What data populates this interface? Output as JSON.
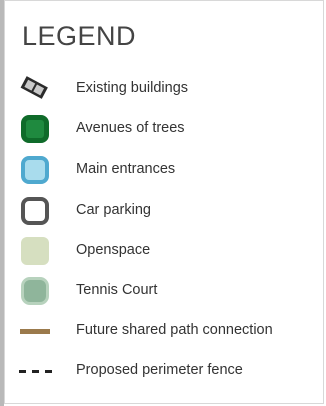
{
  "legend": {
    "title": "LEGEND",
    "items": [
      {
        "label": "Existing buildings",
        "icon": "building-icon",
        "color": "#2b2b2b"
      },
      {
        "label": "Avenues of trees",
        "icon": "trees-swatch",
        "color": "#1f8a3f"
      },
      {
        "label": "Main entrances",
        "icon": "entrance-swatch",
        "color": "#79c3e0"
      },
      {
        "label": "Car parking",
        "icon": "parking-swatch",
        "color": "#555555"
      },
      {
        "label": "Openspace",
        "icon": "openspace-swatch",
        "color": "#d6dfc0"
      },
      {
        "label": "Tennis Court",
        "icon": "tennis-court-swatch",
        "color": "#8fb59b"
      },
      {
        "label": "Future shared path connection",
        "icon": "shared-path-line",
        "color": "#9b7a4c"
      },
      {
        "label": "Proposed perimeter fence",
        "icon": "fence-dashed-line",
        "color": "#222222"
      }
    ]
  }
}
